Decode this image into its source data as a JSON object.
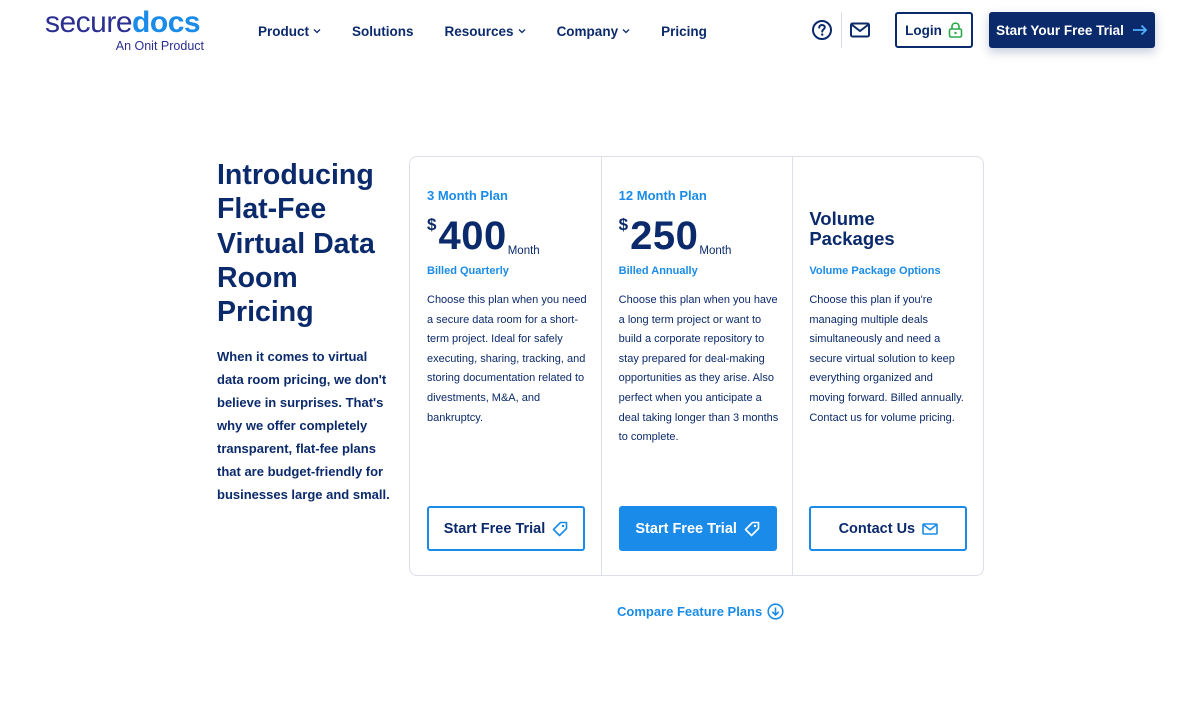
{
  "header": {
    "logo": {
      "word_part1": "secure",
      "word_part2": "docs",
      "tagline": "An Onit Product"
    },
    "nav": [
      {
        "label": "Product",
        "has_dropdown": true
      },
      {
        "label": "Solutions",
        "has_dropdown": false
      },
      {
        "label": "Resources",
        "has_dropdown": true
      },
      {
        "label": "Company",
        "has_dropdown": true
      },
      {
        "label": "Pricing",
        "has_dropdown": false
      }
    ],
    "icons": {
      "help": "question-circle-icon",
      "mail": "mail-icon"
    },
    "login_label": "Login",
    "trial_label": "Start Your Free Trial"
  },
  "intro": {
    "title": "Introducing Flat-Fee Virtual Data Room Pricing",
    "body": "When it comes to virtual data room pricing, we don't believe in surprises. That's why we offer completely transparent, flat-fee plans that are budget-friendly for businesses large and small."
  },
  "plans": [
    {
      "name": "3 Month Plan",
      "currency": "$",
      "amount": "400",
      "period": "Month",
      "billing": "Billed Quarterly",
      "description": "Choose this plan when you need a secure data room for a short-term project. Ideal for safely executing, sharing, tracking, and storing documentation related to divestments, M&A, and bankruptcy.",
      "cta": "Start Free Trial"
    },
    {
      "name": "12 Month Plan",
      "currency": "$",
      "amount": "250",
      "period": "Month",
      "billing": "Billed Annually",
      "description": "Choose this plan when you have a long term project or want to build a corporate repository to stay prepared for deal-making opportunities as they arise. Also perfect when you anticipate a deal taking longer than 3 months to complete.",
      "cta": "Start Free Trial"
    }
  ],
  "volume": {
    "title": "Volume Packages",
    "subtitle": "Volume Package Options",
    "description": "Choose this plan if you're managing multiple deals simultaneously and need a secure virtual solution to keep everything organized and moving forward. Billed annually. Contact us for volume pricing.",
    "cta": "Contact Us"
  },
  "compare_label": "Compare Feature Plans",
  "colors": {
    "navy": "#0b2a6b",
    "blue": "#1a8be8",
    "green": "#2ca84a"
  }
}
